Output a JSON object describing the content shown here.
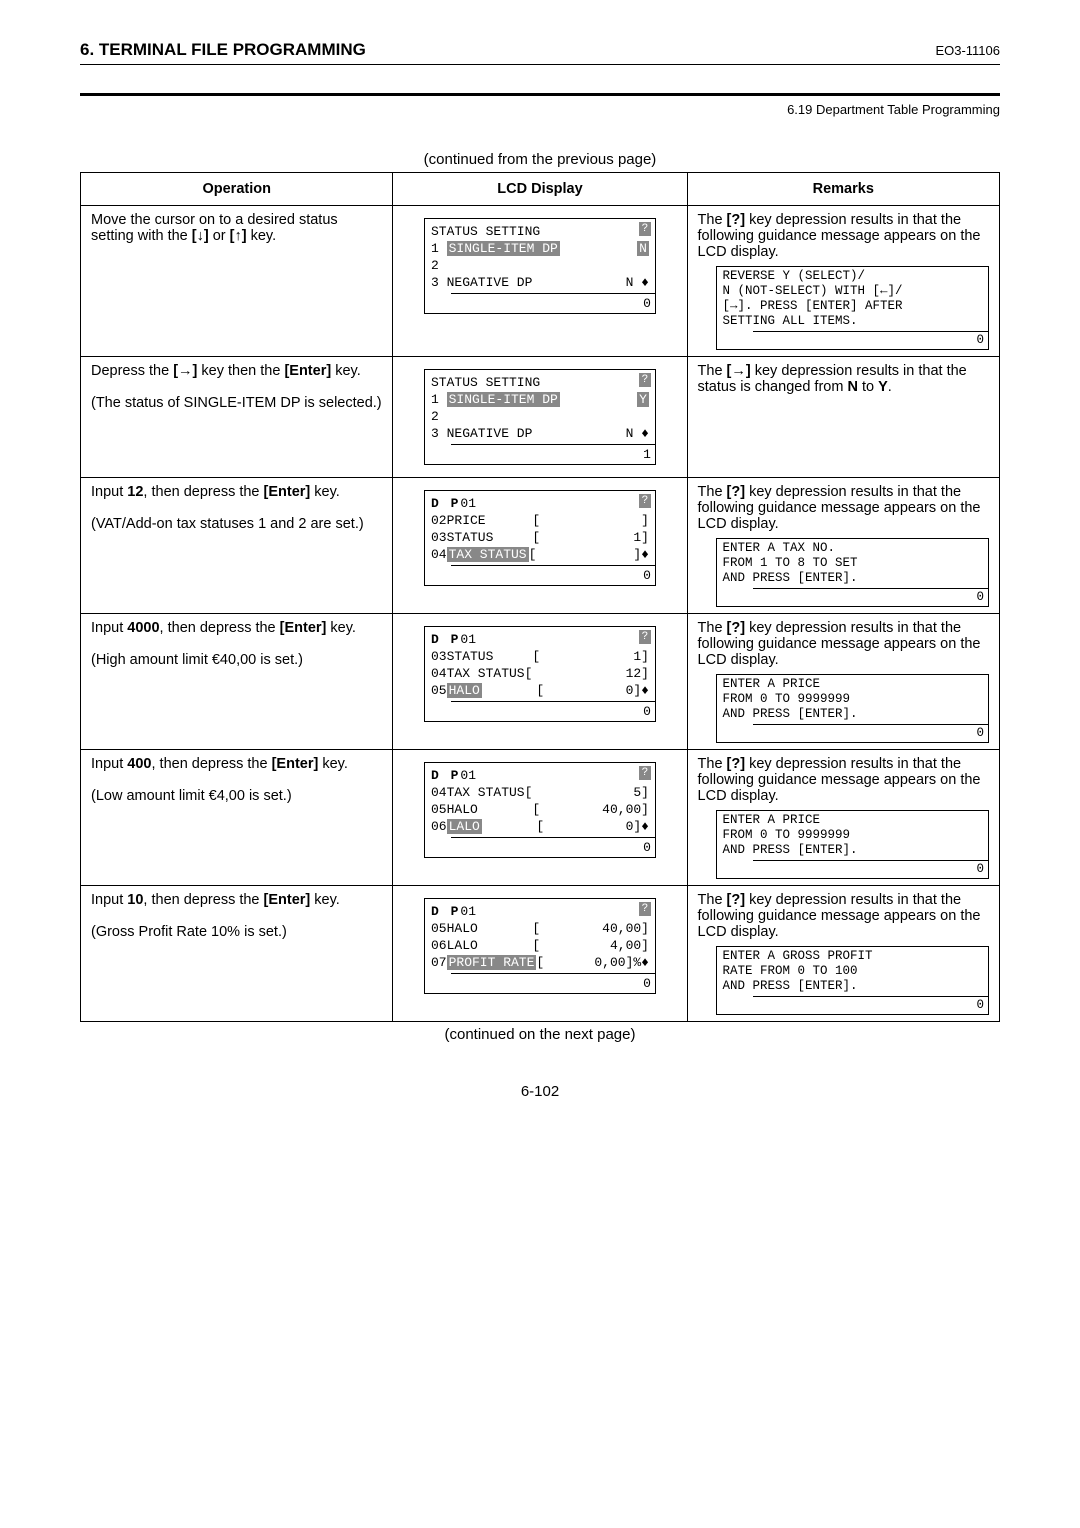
{
  "header": {
    "section_title": "6. TERMINAL FILE PROGRAMMING",
    "doc_code": "EO3-11106",
    "subsection": "6.19 Department Table Programming"
  },
  "continued_top": "(continued from the previous page)",
  "continued_bottom": "(continued on the next page)",
  "table": {
    "headers": {
      "operation": "Operation",
      "lcd": "LCD Display",
      "remarks": "Remarks"
    }
  },
  "rows": [
    {
      "operation_html": "Move the cursor on to a desired status setting with the <b>[↓]</b> or <b>[↑]</b> key.",
      "lcd": {
        "title": "STATUS SETTING",
        "lines": [
          {
            "left": "1 ",
            "inv": "SINGLE-ITEM DP",
            "right_inv": "N"
          },
          {
            "left": "2",
            "right": ""
          },
          {
            "left": "3 NEGATIVE DP",
            "right": "N ♦"
          }
        ],
        "status": "0"
      },
      "remarks_text": "The <b>[?]</b> key depression results in that the following guidance message appears on the LCD display.",
      "gbox": {
        "lines": [
          "REVERSE Y (SELECT)/",
          "N (NOT-SELECT) WITH [←]/",
          "[→]. PRESS [ENTER] AFTER",
          "SETTING ALL ITEMS."
        ],
        "status": "0"
      }
    },
    {
      "operation_html": "Depress the <b>[→]</b> key then the <b>[Enter]</b> key.<br><br>(The status of SINGLE-ITEM DP is selected.)",
      "lcd": {
        "title": "STATUS SETTING",
        "lines": [
          {
            "left": "1 ",
            "inv": "SINGLE-ITEM DP",
            "right_inv": "Y"
          },
          {
            "left": "2",
            "right": ""
          },
          {
            "left": "3 NEGATIVE DP",
            "right": "N ♦"
          }
        ],
        "status": "1"
      },
      "remarks_text": "The <b>[→]</b> key depression results in that the status is changed from <b>N</b> to <b>Y</b>.",
      "gbox": null
    },
    {
      "operation_html": "Input <b>12</b>, then depress the <b>[Enter]</b> key.<br><br>(VAT/Add-on tax statuses 1 and 2 are set.)",
      "lcd": {
        "titleBold": "D P",
        "titleRest": "01",
        "lines": [
          {
            "left": "02PRICE      [",
            "right": "]"
          },
          {
            "left": "03STATUS     [",
            "right": "1]"
          },
          {
            "left": "04",
            "inv": "TAX STATUS",
            "mid": "[",
            "right": "]♦"
          }
        ],
        "status": "0"
      },
      "remarks_text": "The <b>[?]</b> key depression results in that the following guidance message appears on the LCD display.",
      "gbox": {
        "lines": [
          "ENTER A TAX NO.",
          "FROM 1 TO 8 TO SET",
          "AND PRESS [ENTER]."
        ],
        "status": "0"
      }
    },
    {
      "operation_html": "Input <b>4000</b>, then depress the <b>[Enter]</b> key.<br><br>(High amount limit €40,00 is set.)",
      "lcd": {
        "titleBold": "D P",
        "titleRest": "01",
        "lines": [
          {
            "left": "03STATUS     [",
            "right": "1]"
          },
          {
            "left": "04TAX STATUS[",
            "right": "12]"
          },
          {
            "left": "05",
            "inv": "HALO",
            "mid": "       [",
            "right": "0]♦"
          }
        ],
        "status": "0"
      },
      "remarks_text": "The <b>[?]</b> key depression results in that the following guidance message appears on the LCD display.",
      "gbox": {
        "lines": [
          "ENTER A PRICE",
          "FROM 0 TO 9999999",
          "AND PRESS [ENTER]."
        ],
        "status": "0"
      }
    },
    {
      "operation_html": "Input <b>400</b>, then depress the <b>[Enter]</b> key.<br><br>(Low amount limit €4,00 is set.)",
      "lcd": {
        "titleBold": "D P",
        "titleRest": "01",
        "lines": [
          {
            "left": "04TAX STATUS[",
            "right": "5]"
          },
          {
            "left": "05HALO       [",
            "right": "40,00]"
          },
          {
            "left": "06",
            "inv": "LALO",
            "mid": "       [",
            "right": "0]♦"
          }
        ],
        "status": "0"
      },
      "remarks_text": "The <b>[?]</b> key depression results in that the following guidance message appears on the LCD display.",
      "gbox": {
        "lines": [
          "ENTER A PRICE",
          "FROM 0 TO 9999999",
          "AND PRESS [ENTER]."
        ],
        "status": "0"
      }
    },
    {
      "operation_html": "Input <b>10</b>, then depress the <b>[Enter]</b> key.<br><br>(Gross Profit Rate 10% is set.)",
      "lcd": {
        "titleBold": "D P",
        "titleRest": "01",
        "lines": [
          {
            "left": "05HALO       [",
            "right": "40,00]"
          },
          {
            "left": "06LALO       [",
            "right": "4,00]"
          },
          {
            "left": "07",
            "inv": "PROFIT RATE",
            "mid": "[",
            "right": "0,00]%♦"
          }
        ],
        "status": "0"
      },
      "remarks_text": "The <b>[?]</b> key depression results in that the following guidance message appears on the LCD display.",
      "gbox": {
        "lines": [
          "ENTER A GROSS PROFIT",
          "RATE FROM 0 TO 100",
          "AND PRESS [ENTER]."
        ],
        "status": "0"
      }
    }
  ],
  "page_num": "6-102"
}
